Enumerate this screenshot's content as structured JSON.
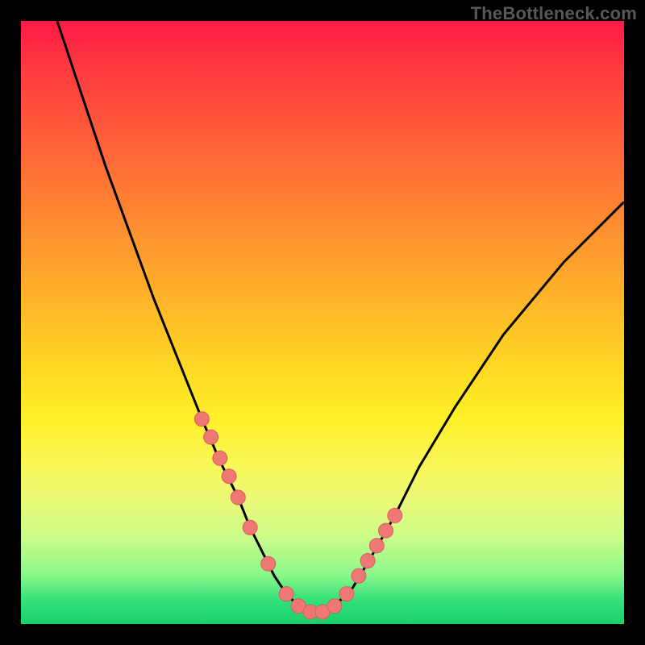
{
  "watermark": "TheBottleneck.com",
  "colors": {
    "page_bg": "#000000",
    "curve_stroke": "#000000",
    "marker_fill": "#ef7874",
    "marker_stroke": "#d85f5c",
    "gradient_top": "#ff1a47",
    "gradient_bottom": "#1ad06a"
  },
  "chart_data": {
    "type": "line",
    "title": "",
    "xlabel": "",
    "ylabel": "",
    "xlim": [
      0,
      100
    ],
    "ylim": [
      0,
      100
    ],
    "series": [
      {
        "name": "bottleneck-curve",
        "x": [
          6,
          10,
          14,
          18,
          22,
          26,
          30,
          33,
          36,
          38,
          40,
          42,
          44,
          46,
          48,
          50,
          52,
          55,
          58,
          62,
          66,
          72,
          80,
          90,
          100
        ],
        "y": [
          100,
          88,
          76,
          65,
          54,
          44,
          34,
          27,
          21,
          16,
          12,
          8,
          5,
          3,
          2,
          2,
          3,
          6,
          11,
          18,
          26,
          36,
          48,
          60,
          70
        ]
      }
    ],
    "markers": {
      "name": "highlighted-points",
      "x": [
        30,
        31.5,
        33,
        34.5,
        36,
        38,
        41,
        44,
        46,
        48,
        50,
        52,
        54,
        56,
        57.5,
        59,
        60.5,
        62
      ],
      "y": [
        34,
        31,
        27.5,
        24.5,
        21,
        16,
        10,
        5,
        3,
        2,
        2,
        3,
        5,
        8,
        10.5,
        13,
        15.5,
        18
      ]
    }
  }
}
